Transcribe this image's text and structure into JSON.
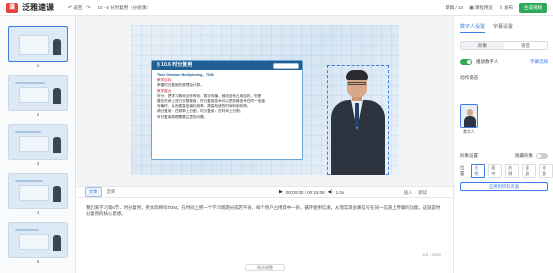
{
  "app": {
    "logo_text": "泛雅速课",
    "doc_title": "10 - 6 分时复用（分组课）"
  },
  "toolbar": {
    "back_label": "返回",
    "undo_label": "",
    "redo_label": "",
    "save_status": "草稿 / 10",
    "preview_label": "课程预览",
    "publish_label": "发布",
    "generate_label": "生成视频"
  },
  "slides": [
    {
      "num": "1"
    },
    {
      "num": "2"
    },
    {
      "num": "3"
    },
    {
      "num": "4"
    },
    {
      "num": "5"
    }
  ],
  "slide": {
    "card_title": "§ 10.6 时分复用",
    "card_subtitle": "Time Division Multiplexing，TDM",
    "line1": "教学目标",
    "line2": "掌握时分复用的原理及计算。",
    "line3": "教学重点",
    "body1": "时分：把学习期间当作有效、数字传输。频段没有占用结构，但是",
    "body2": "要在时间上进行交替使用，时分复用技术可以把多路信号在同一信道",
    "body3": "传输时，从而提高信道利用率，提高系统的时间利用效率。",
    "body4": "频分复用：在频率上分割，时分复用：在时间上分割。",
    "body5": "时分复用原理需要注意的问题。"
  },
  "player": {
    "tab_script": "文本",
    "tab_audio": "音频",
    "time": "00:00:00 / 00:15:06",
    "speed": "1.0x",
    "extra1": "插入",
    "extra2": "朗读"
  },
  "script": {
    "text": "我们来学习第6节，时分复用，英文简称叫TDM。在时间上把一个学习周期分成若干份，每个用户占用其中一份，循环使用信道，从而实现多路信号在同一信道上传输的功能，这就是时分复用的核心思想。",
    "count": "101 / 3000",
    "handle_label": "拖动调整"
  },
  "panel": {
    "tab_person": "数字人设置",
    "tab_subtitle": "字幕设置",
    "seg_on": "形象",
    "seg_off": "语音",
    "voice_label": "播放数字人",
    "voice_action": "字幕选择",
    "section_person": "动作姿态",
    "avatar_name": "数字人",
    "size_label": "形象设置",
    "bg_label": "隐藏形象",
    "pos_label": "位置",
    "pos_chips": [
      "左侧",
      "居中",
      "右侧",
      "全身",
      "半身"
    ],
    "apply_all": "应用到所有页面"
  }
}
